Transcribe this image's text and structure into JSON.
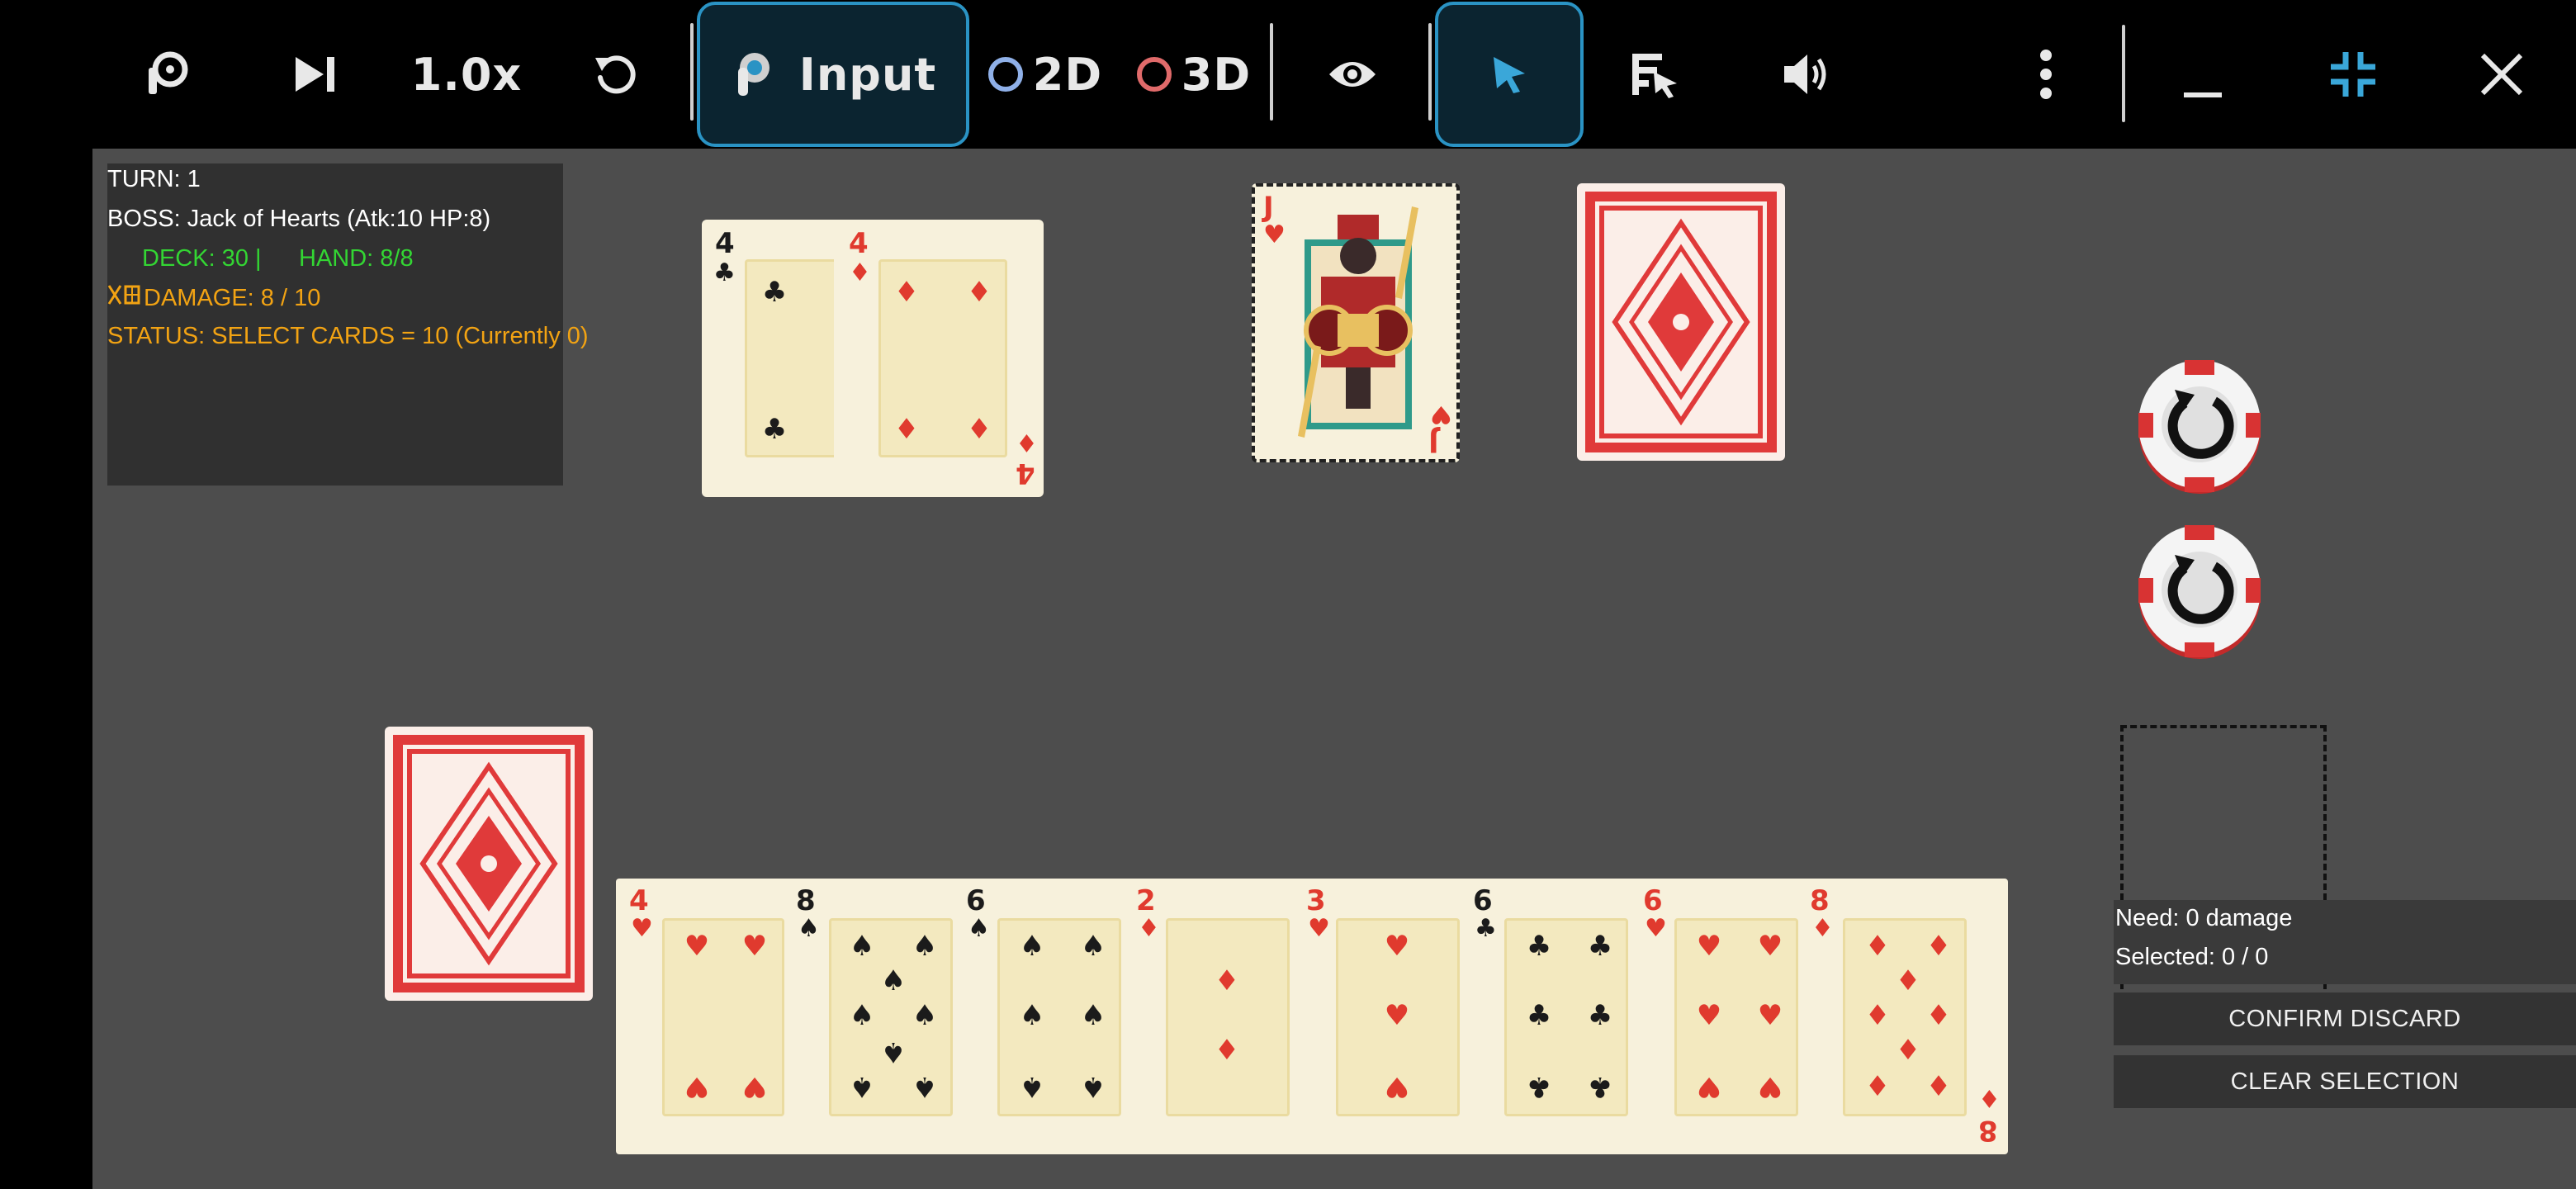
{
  "toolbar": {
    "speed_label": "1.0x",
    "input_label": "Input",
    "mode_2d_label": "2D",
    "mode_3d_label": "3D",
    "icons": [
      "paw-cursor-icon",
      "skip-forward-icon",
      "restart-icon",
      "touch-input-icon",
      "eye-icon",
      "pointer-icon",
      "script-cursor-icon",
      "volume-icon",
      "more-vert-icon",
      "minimize-icon",
      "collapse-icon",
      "close-icon"
    ],
    "colors": {
      "active_border": "#2a93c4",
      "ring_2d": "#8fb0e8",
      "ring_3d": "#e06a6a",
      "collapse_icon": "#3aa7d9"
    }
  },
  "info_panel": {
    "turn": "TURN: 1",
    "boss": "BOSS: Jack of Hearts (Atk:10 HP:8)",
    "deck": "DECK: 30 |",
    "hand": "HAND: 8/8",
    "damage": "DAMAGE: 8 / 10",
    "status": "STATUS: SELECT CARDS = 10 (Currently 0)",
    "colors": {
      "deck_hand": "#33d633",
      "damage_status": "#f2a313"
    }
  },
  "played_cards": [
    {
      "rank": "4",
      "suit": "♣",
      "color": "black"
    },
    {
      "rank": "4",
      "suit": "♦",
      "color": "red"
    }
  ],
  "boss_card": {
    "rank": "J",
    "suit": "♥",
    "name": "Jack of Hearts"
  },
  "hand": [
    {
      "rank": "4",
      "suit": "♥",
      "color": "red"
    },
    {
      "rank": "8",
      "suit": "♠",
      "color": "black"
    },
    {
      "rank": "6",
      "suit": "♠",
      "color": "black"
    },
    {
      "rank": "2",
      "suit": "♦",
      "color": "red"
    },
    {
      "rank": "3",
      "suit": "♥",
      "color": "red"
    },
    {
      "rank": "6",
      "suit": "♣",
      "color": "black"
    },
    {
      "rank": "6",
      "suit": "♥",
      "color": "red"
    },
    {
      "rank": "8",
      "suit": "♦",
      "color": "red"
    }
  ],
  "discard_panel": {
    "need": "Need: 0 damage",
    "selected": "Selected: 0 / 0",
    "confirm_label": "CONFIRM DISCARD",
    "clear_label": "CLEAR SELECTION"
  },
  "jester_tokens": 2
}
